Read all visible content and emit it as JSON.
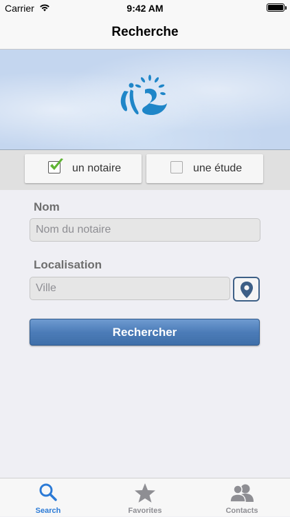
{
  "status": {
    "carrier": "Carrier",
    "time": "9:42 AM"
  },
  "nav": {
    "title": "Recherche"
  },
  "type_selector": {
    "options": [
      {
        "label": "un notaire",
        "checked": true
      },
      {
        "label": "une étude",
        "checked": false
      }
    ]
  },
  "form": {
    "name_label": "Nom",
    "name_placeholder": "Nom du notaire",
    "name_value": "",
    "location_label": "Localisation",
    "location_placeholder": "Ville",
    "location_value": "",
    "submit_label": "Rechercher"
  },
  "tabs": [
    {
      "label": "Search",
      "icon": "search-icon",
      "active": true
    },
    {
      "label": "Favorites",
      "icon": "star-icon",
      "active": false
    },
    {
      "label": "Contacts",
      "icon": "contacts-icon",
      "active": false
    }
  ],
  "colors": {
    "accent": "#2b7ad6",
    "button": "#4c7cb8",
    "logo": "#1f86c8"
  }
}
